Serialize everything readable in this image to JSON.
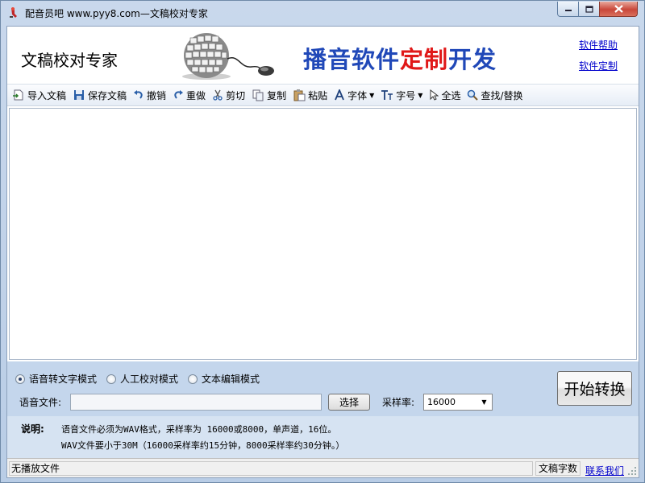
{
  "window": {
    "title": "配音员吧 www.pyy8.com—文稿校对专家"
  },
  "banner": {
    "app_name": "文稿校对专家",
    "slogan_part1": "播音软件",
    "slogan_part2": "定制",
    "slogan_part3": "开发",
    "help_link": "软件帮助",
    "custom_link": "软件定制"
  },
  "toolbar": {
    "import": "导入文稿",
    "save": "保存文稿",
    "undo": "撤销",
    "redo": "重做",
    "cut": "剪切",
    "copy": "复制",
    "paste": "粘贴",
    "font": "字体",
    "size": "字号",
    "select_all": "全选",
    "find_replace": "查找/替换"
  },
  "editor": {
    "content": ""
  },
  "panel": {
    "modes": [
      {
        "label": "语音转文字模式",
        "checked": true
      },
      {
        "label": "人工校对模式",
        "checked": false
      },
      {
        "label": "文本编辑模式",
        "checked": false
      }
    ],
    "file_label": "语音文件:",
    "file_value": "",
    "browse_label": "选择",
    "rate_label": "采样率:",
    "rate_value": "16000",
    "start_label": "开始转换",
    "notes_label": "说明:",
    "note1": "语音文件必须为WAV格式，采样率为 16000或8000，单声道，16位。",
    "note2": "WAV文件要小于30M（16000采样率约15分钟，8000采样率约30分钟。）"
  },
  "status": {
    "left": "无播放文件",
    "count_label": "文稿字数",
    "contact_link": "联系我们"
  },
  "colors": {
    "slogan_blue": "#2048b8",
    "slogan_red": "#e01818",
    "link": "#0000cc",
    "panel_bg": "#c4d6ec"
  }
}
